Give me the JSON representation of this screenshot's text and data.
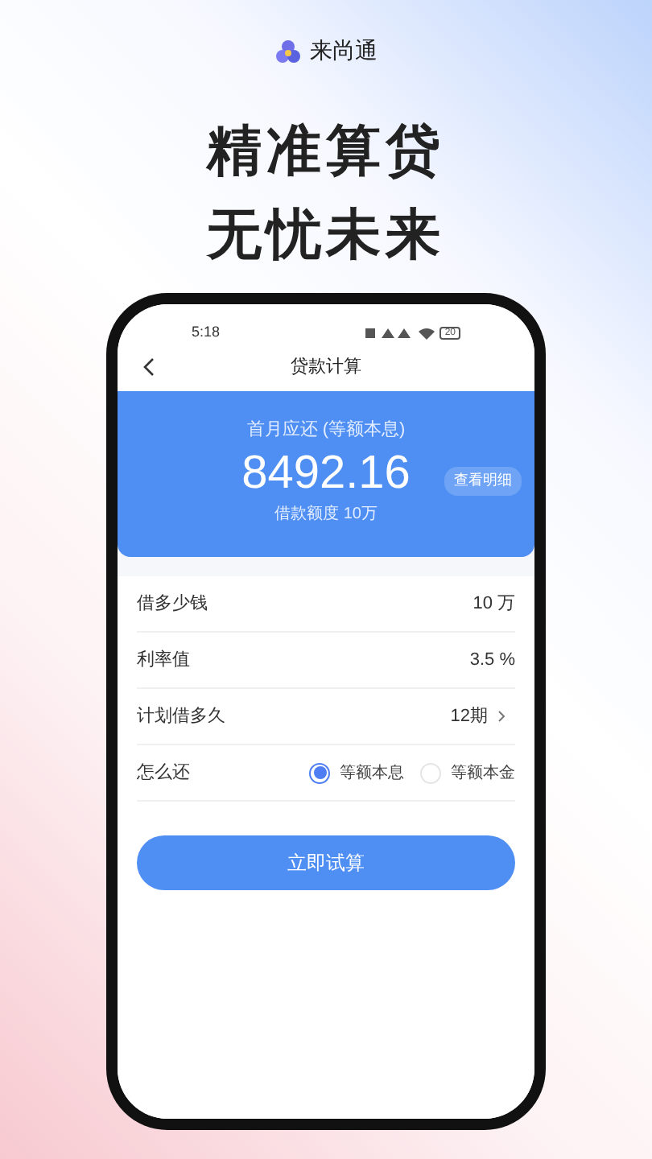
{
  "brand": {
    "name": "来尚通"
  },
  "headline": [
    "精准算贷",
    "无忧未来"
  ],
  "phone": {
    "time": "5:18",
    "battery": "20",
    "title": "贷款计算",
    "summary": {
      "label": "首月应还 (等额本息)",
      "amount": "8492.16",
      "detail_button": "查看明细",
      "note": "借款额度 10万"
    },
    "rows": [
      {
        "kind": "value",
        "label": "借多少钱",
        "value": "10 万"
      },
      {
        "kind": "value",
        "label": "利率值",
        "value": "3.5 %"
      },
      {
        "kind": "picker",
        "label": "计划借多久",
        "value": "12期"
      },
      {
        "kind": "radio",
        "label": "怎么还",
        "options": [
          {
            "label": "等额本息",
            "selected": true
          },
          {
            "label": "等额本金",
            "selected": false
          }
        ]
      }
    ],
    "submit": "立即试算"
  }
}
